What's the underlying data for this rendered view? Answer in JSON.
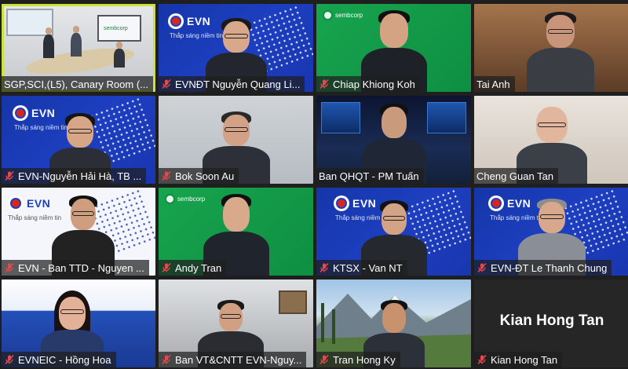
{
  "participants": [
    {
      "name": "SGP,SCI,(L5), Canary Room (...",
      "muted": false,
      "active": true
    },
    {
      "name": "EVNĐT Nguyễn Quang Li...",
      "muted": true
    },
    {
      "name": "Chiap Khiong Koh",
      "muted": true
    },
    {
      "name": "Tai Anh",
      "muted": false
    },
    {
      "name": "EVN-Nguyễn Hải Hà, TB ...",
      "muted": true
    },
    {
      "name": "Bok Soon Au",
      "muted": true
    },
    {
      "name": "Ban QHQT - PM Tuấn",
      "muted": false
    },
    {
      "name": "Cheng Guan Tan",
      "muted": false
    },
    {
      "name": "EVN - Ban TTD - Nguyen ...",
      "muted": true
    },
    {
      "name": "Andy Tran",
      "muted": true
    },
    {
      "name": "KTSX - Van NT",
      "muted": true
    },
    {
      "name": "EVN-ĐT Le Thanh Chung",
      "muted": true
    },
    {
      "name": "EVNEIC - Hồng Hoa",
      "muted": true
    },
    {
      "name": "Ban VT&CNTT EVN-Nguy...",
      "muted": true
    },
    {
      "name": "Tran Hong Ky",
      "muted": true
    },
    {
      "name": "Kian Hong Tan",
      "muted": true,
      "video_off": true
    }
  ],
  "branding": {
    "evn_logo": "EVN",
    "evn_tagline": "Thắp sáng niềm tin",
    "sembcorp_logo": "sembcorp",
    "kian_display_name": "Kian Hong Tan"
  },
  "colors": {
    "active_speaker_border": "#c9e33b",
    "muted_icon": "#e5484d",
    "evn_blue": "#1d3fc0",
    "sembcorp_green": "#17a44e"
  },
  "icons": {
    "muted": "mic-off-icon"
  }
}
